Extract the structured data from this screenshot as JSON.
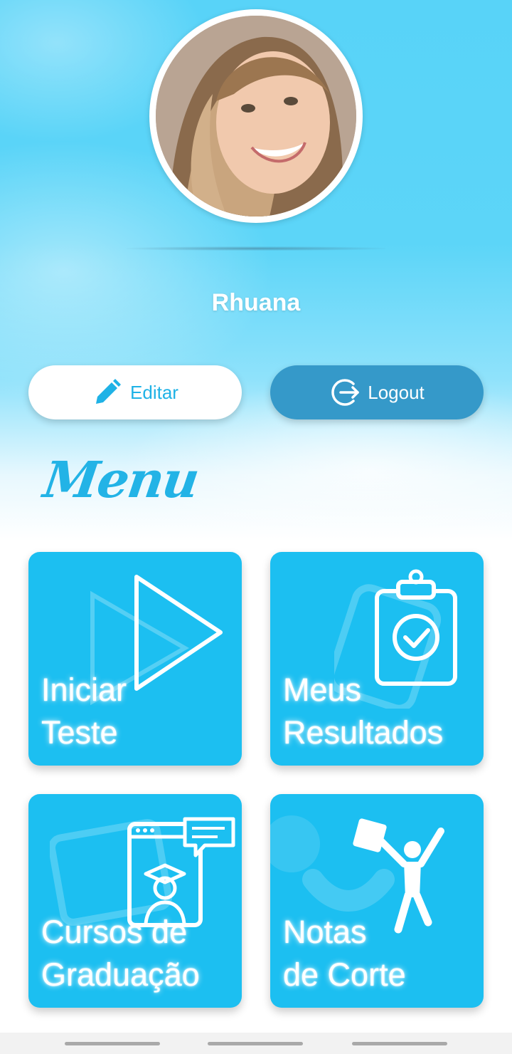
{
  "profile": {
    "name": "Rhuana"
  },
  "actions": {
    "edit_label": "Editar",
    "logout_label": "Logout"
  },
  "menu": {
    "title": "Menu",
    "tiles": [
      {
        "label": "Iniciar\nTeste",
        "icon": "play-icon"
      },
      {
        "label": "Meus\nResultados",
        "icon": "clipboard-check-icon"
      },
      {
        "label": "Cursos de\nGraduação",
        "icon": "graduate-screen-icon"
      },
      {
        "label": "Notas\nde Corte",
        "icon": "celebrating-person-icon"
      }
    ]
  },
  "colors": {
    "tile": "#1cbff1",
    "accent": "#1fb2e6",
    "logout": "#3599c9"
  }
}
